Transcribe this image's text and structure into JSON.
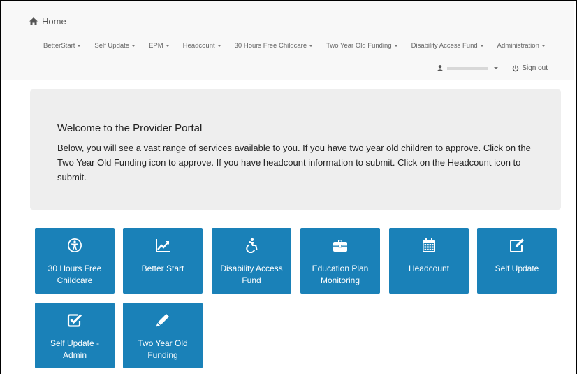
{
  "navbar": {
    "home_label": "Home",
    "menu": [
      {
        "label": "BetterStart"
      },
      {
        "label": "Self Update"
      },
      {
        "label": "EPM"
      },
      {
        "label": "Headcount"
      },
      {
        "label": "30 Hours Free Childcare"
      },
      {
        "label": "Two Year Old Funding"
      },
      {
        "label": "Disability Access Fund"
      },
      {
        "label": "Administration"
      }
    ],
    "signout_label": "Sign out"
  },
  "welcome": {
    "title": "Welcome to the Provider Portal",
    "body": "Below, you will see a vast range of services available to you. If you have two year old children to approve. Click on the Two Year Old Funding icon to approve. If you have headcount information to submit. Click on the Headcount icon to submit."
  },
  "tiles": [
    {
      "label": "30 Hours Free Childcare",
      "icon": "accessibility-icon"
    },
    {
      "label": "Better Start",
      "icon": "line-chart-icon"
    },
    {
      "label": "Disability Access Fund",
      "icon": "wheelchair-icon"
    },
    {
      "label": "Education Plan Monitoring",
      "icon": "briefcase-icon"
    },
    {
      "label": "Headcount",
      "icon": "calendar-icon"
    },
    {
      "label": "Self Update",
      "icon": "edit-icon"
    },
    {
      "label": "Self Update - Admin",
      "icon": "checkbox-icon"
    },
    {
      "label": "Two Year Old Funding",
      "icon": "pencil-icon"
    }
  ],
  "colors": {
    "tile": "#1a81b8",
    "navbar": "#f8f8f8",
    "jumbotron": "#eeeeee"
  }
}
